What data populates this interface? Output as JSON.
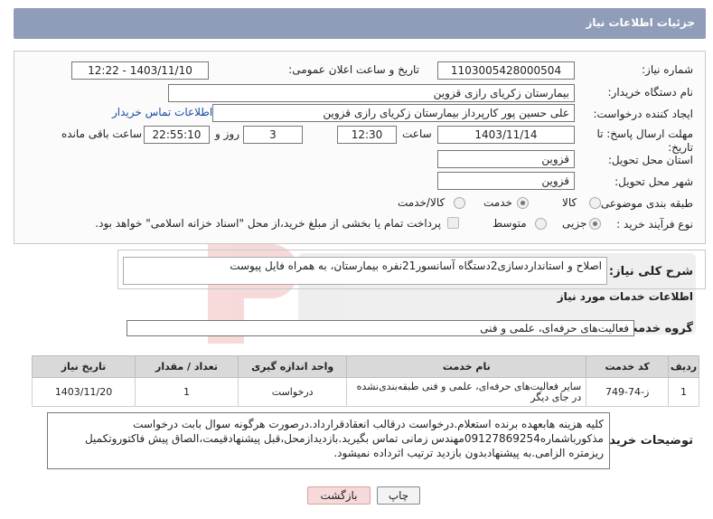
{
  "header": {
    "title": "جزئیات اطلاعات نیاز"
  },
  "form": {
    "need_number_label": "شماره نیاز:",
    "need_number": "1103005428000504",
    "announce_label": "تاریخ و ساعت اعلان عمومی:",
    "announce_value": "1403/11/10 - 12:22",
    "buyer_org_label": "نام دستگاه خریدار:",
    "buyer_org": "بیمارستان زکریای رازی قزوین",
    "creator_label": "ایجاد کننده درخواست:",
    "creator": "علی حسین پور کارپرداز بیمارستان زکریای رازی قزوین",
    "contact_link": "اطلاعات تماس خریدار",
    "deadline_label_1": "مهلت ارسال پاسخ: تا",
    "deadline_label_2": "تاریخ:",
    "deadline_date": "1403/11/14",
    "time_label": "ساعت",
    "deadline_time": "12:30",
    "days_value": "3",
    "days_label": "روز و",
    "remaining_time": "22:55:10",
    "remaining_label": "ساعت باقی مانده",
    "province_label": "استان محل تحویل:",
    "province": "قزوین",
    "city_label": "شهر محل تحویل:",
    "city": "قزوین",
    "category_label": "طبقه بندی موضوعی:",
    "category_options": [
      "کالا",
      "خدمت",
      "کالا/خدمت"
    ],
    "category_selected": 1,
    "process_label": "نوع فرآیند خرید :",
    "process_options": [
      "جزیی",
      "متوسط"
    ],
    "process_selected": 0,
    "payment_note": "پرداخت تمام یا بخشی از مبلغ خرید،از محل \"اسناد خزانه اسلامی\" خواهد بود."
  },
  "summary": {
    "label": "شرح کلی نیاز:",
    "text": "اصلاح و استانداردسازی2دستگاه آسانسور21نفره بیمارستان، به همراه فایل پیوست"
  },
  "services": {
    "section_title": "اطلاعات خدمات مورد نیاز",
    "group_label": "گروه خدمت:",
    "group_value": "فعالیت‌های حرفه‌ای، علمی و فنی",
    "columns": [
      "ردیف",
      "کد خدمت",
      "نام خدمت",
      "واحد اندازه گیری",
      "تعداد / مقدار",
      "تاریخ نیاز"
    ],
    "rows": [
      {
        "row": "1",
        "code": "ز-74-749",
        "name": "سایر فعالیت‌های حرفه‌ای، علمی و فنی طبقه‌بندی‌نشده در جای دیگر",
        "unit": "درخواست",
        "qty": "1",
        "date": "1403/11/20"
      }
    ]
  },
  "buyer_notes": {
    "label": "توضیحات خریدار:",
    "text": "کلیه هزینه هابعهده برنده استعلام.درخواست درقالب انعقادقرارداد.درصورت هرگونه سوال بابت درخواست مذکورباشماره09127869254مهندس زمانی تماس بگیرید.بازدیدازمحل،قبل پیشنهادقیمت،الصاق پیش فاکتوروتکمیل ریزمتره الزامی.به پیشنهادبدون بازدید ترتیب اثرداده نمیشود."
  },
  "buttons": {
    "print": "چاپ",
    "back": "بازگشت"
  },
  "colors": {
    "header": "#8f9db8",
    "back_button": "#f6dada",
    "link": "#1a4fa0"
  }
}
